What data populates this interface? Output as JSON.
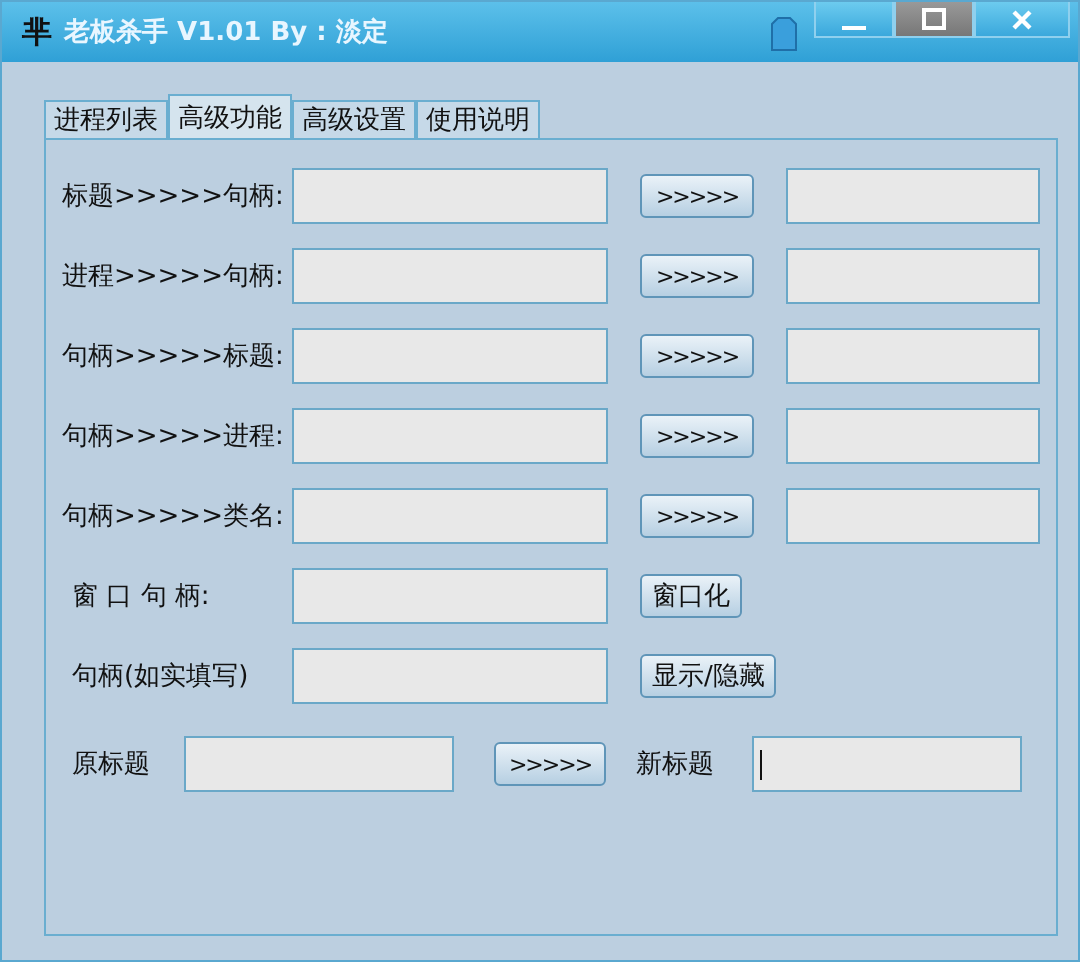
{
  "window": {
    "icon_glyph": "芈",
    "title": "老板杀手 V1.01 By : 淡定"
  },
  "tabs": [
    {
      "label": "进程列表",
      "selected": false
    },
    {
      "label": "高级功能",
      "selected": true
    },
    {
      "label": "高级设置",
      "selected": false
    },
    {
      "label": "使用说明",
      "selected": false
    }
  ],
  "rows": [
    {
      "kind": "convert",
      "label": "标题>>>>>句柄:",
      "button": ">>>>>"
    },
    {
      "kind": "convert",
      "label": "进程>>>>>句柄:",
      "button": ">>>>>"
    },
    {
      "kind": "convert",
      "label": "句柄>>>>>标题:",
      "button": ">>>>>"
    },
    {
      "kind": "convert",
      "label": "句柄>>>>>进程:",
      "button": ">>>>>"
    },
    {
      "kind": "convert",
      "label": "句柄>>>>>类名:",
      "button": ">>>>>"
    },
    {
      "kind": "action",
      "label": "窗 口 句 柄:",
      "button": "窗口化"
    },
    {
      "kind": "action",
      "label": "句柄(如实填写)",
      "button": "显示/隐藏"
    }
  ],
  "rename": {
    "old_label": "原标题",
    "button": ">>>>>",
    "new_label": "新标题",
    "new_focused": true
  }
}
